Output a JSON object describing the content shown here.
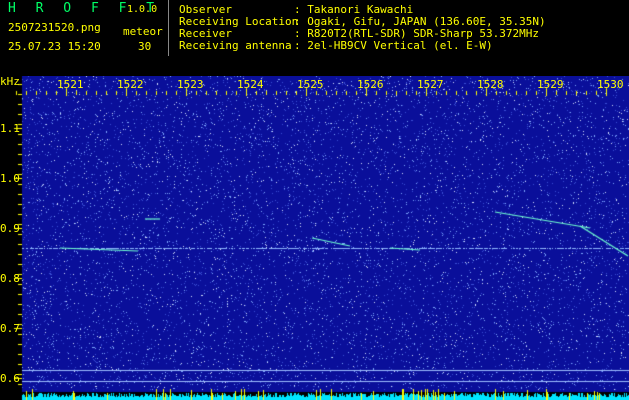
{
  "header": {
    "logo": "H R O F F T",
    "version": "1.0.0",
    "filename": "2507231520.png",
    "datetime": "25.07.23 15:20",
    "meteor_label": "meteor",
    "meteor_count": "30",
    "info": [
      {
        "label": "Observer",
        "value": ": Takanori Kawachi"
      },
      {
        "label": "Receiving Location",
        "value": ": Ogaki, Gifu, JAPAN (136.60E, 35.35N)"
      },
      {
        "label": "Receiver",
        "value": ": R820T2(RTL-SDR) SDR-Sharp 53.372MHz"
      },
      {
        "label": "Receiving antenna",
        "value": ": 2el-HB9CV Vertical (el. E-W)"
      }
    ]
  },
  "spectrogram": {
    "y_unit": "kHz",
    "y_ticks": [
      "1.1",
      "1.0",
      "0.9",
      "0.8",
      "0.7",
      "0.6"
    ],
    "minute_labels": [
      "1521",
      "1522",
      "1523",
      "1524",
      "1525",
      "1526",
      "1527",
      "1528",
      "1529",
      "1530"
    ],
    "colors": {
      "background": "#0a0f9a",
      "noise": "#7fa8ff",
      "signal": "#6fffd0",
      "tick": "#ffff00",
      "activity": "#00e5ff",
      "activity_peak": "#ffff00"
    }
  }
}
